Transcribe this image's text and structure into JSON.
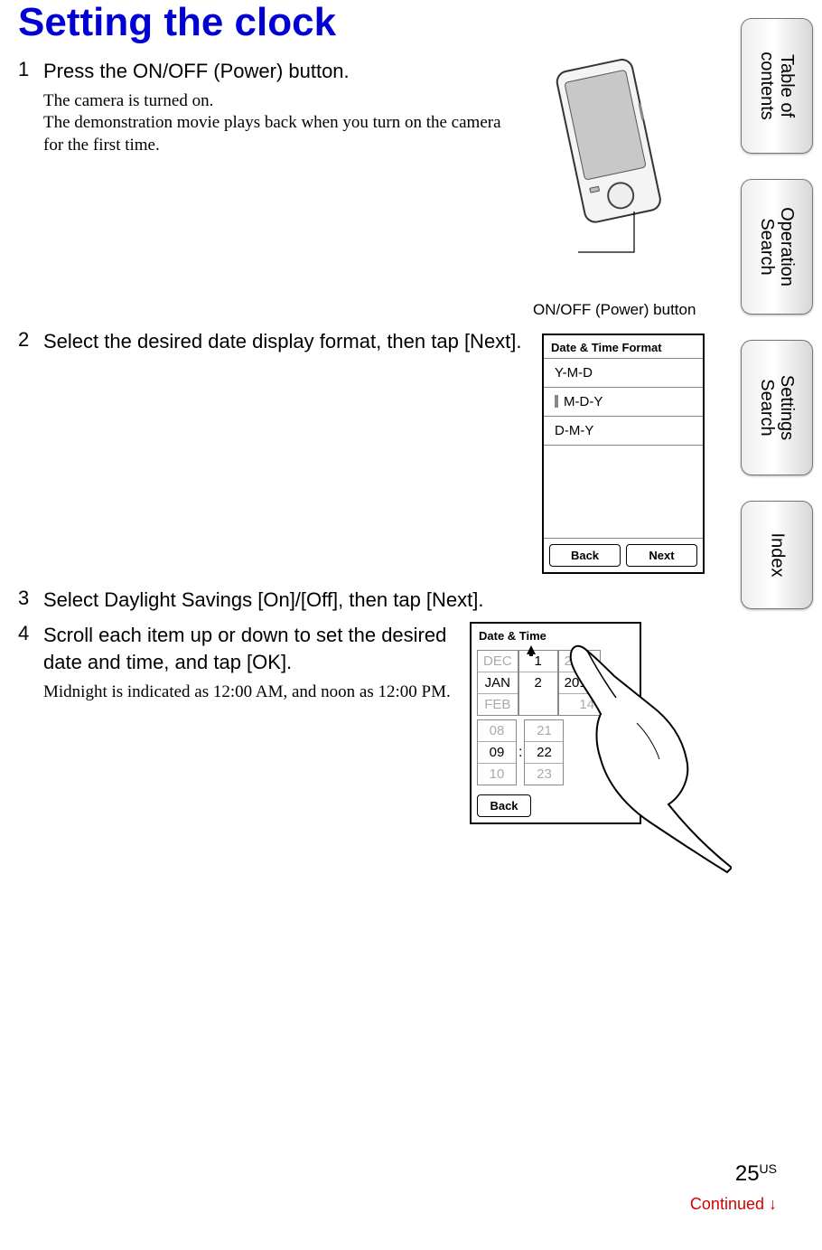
{
  "title": "Setting the clock",
  "steps": {
    "s1": {
      "num": "1",
      "title": "Press the ON/OFF (Power) button.",
      "desc1": "The camera is turned on.",
      "desc2": "The demonstration movie plays back when you turn on the camera for the first time."
    },
    "s2": {
      "num": "2",
      "title": "Select the desired date display format, then tap [Next]."
    },
    "s3": {
      "num": "3",
      "title": "Select Daylight Savings [On]/[Off], then tap [Next]."
    },
    "s4": {
      "num": "4",
      "title": "Scroll each item up or down to set the desired date and time, and tap [OK].",
      "desc": "Midnight is indicated as 12:00 AM, and noon as 12:00 PM."
    }
  },
  "camera_caption": "ON/OFF (Power) button",
  "sideTabs": {
    "toc": "Table of\ncontents",
    "op": "Operation\nSearch",
    "set": "Settings\nSearch",
    "idx": "Index"
  },
  "screen1": {
    "header": "Date & Time Format",
    "options": [
      "Y-M-D",
      "M-D-Y",
      "D-M-Y"
    ],
    "selectedIndex": 1,
    "back": "Back",
    "next": "Next"
  },
  "screen2": {
    "header": "Date & Time",
    "months": [
      "DEC",
      "JAN",
      "FEB"
    ],
    "days": [
      "1",
      "2"
    ],
    "years": [
      "2012",
      "2013",
      "14"
    ],
    "hours": [
      "08",
      "09",
      "10"
    ],
    "minutes": [
      "21",
      "22",
      "23"
    ],
    "back": "Back"
  },
  "pageNumber": "25",
  "pageSuffix": "US",
  "continued": "Continued ↓"
}
